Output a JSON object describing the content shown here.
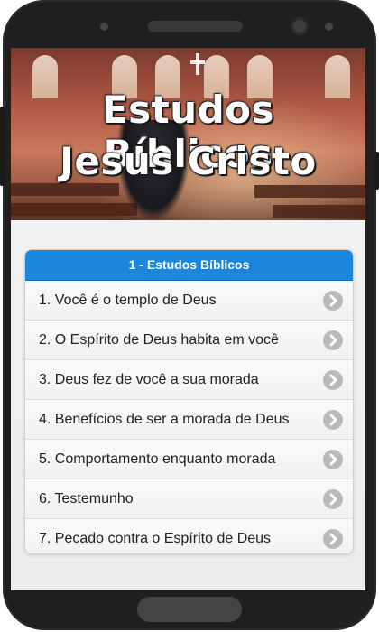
{
  "banner": {
    "title_line1": "Estudos Bíblicos",
    "title_line2": "Jesus Cristo"
  },
  "list": {
    "header": "1 - Estudos Bíblicos",
    "items": [
      {
        "label": "1. Você é o templo de Deus"
      },
      {
        "label": "2. O Espírito de Deus habita em você"
      },
      {
        "label": "3. Deus fez de você a sua morada"
      },
      {
        "label": "4. Benefícios de ser a morada de Deus"
      },
      {
        "label": "5. Comportamento enquanto morada"
      },
      {
        "label": "6. Testemunho"
      },
      {
        "label": "7. Pecado contra o Espírito de Deus"
      }
    ]
  },
  "colors": {
    "header_blue": "#1b86dc",
    "chevron_gray": "#b9b9b9",
    "phone_frame": "#1f1f1f"
  },
  "icons": {
    "item_arrow": "chevron-right-circle-icon"
  }
}
